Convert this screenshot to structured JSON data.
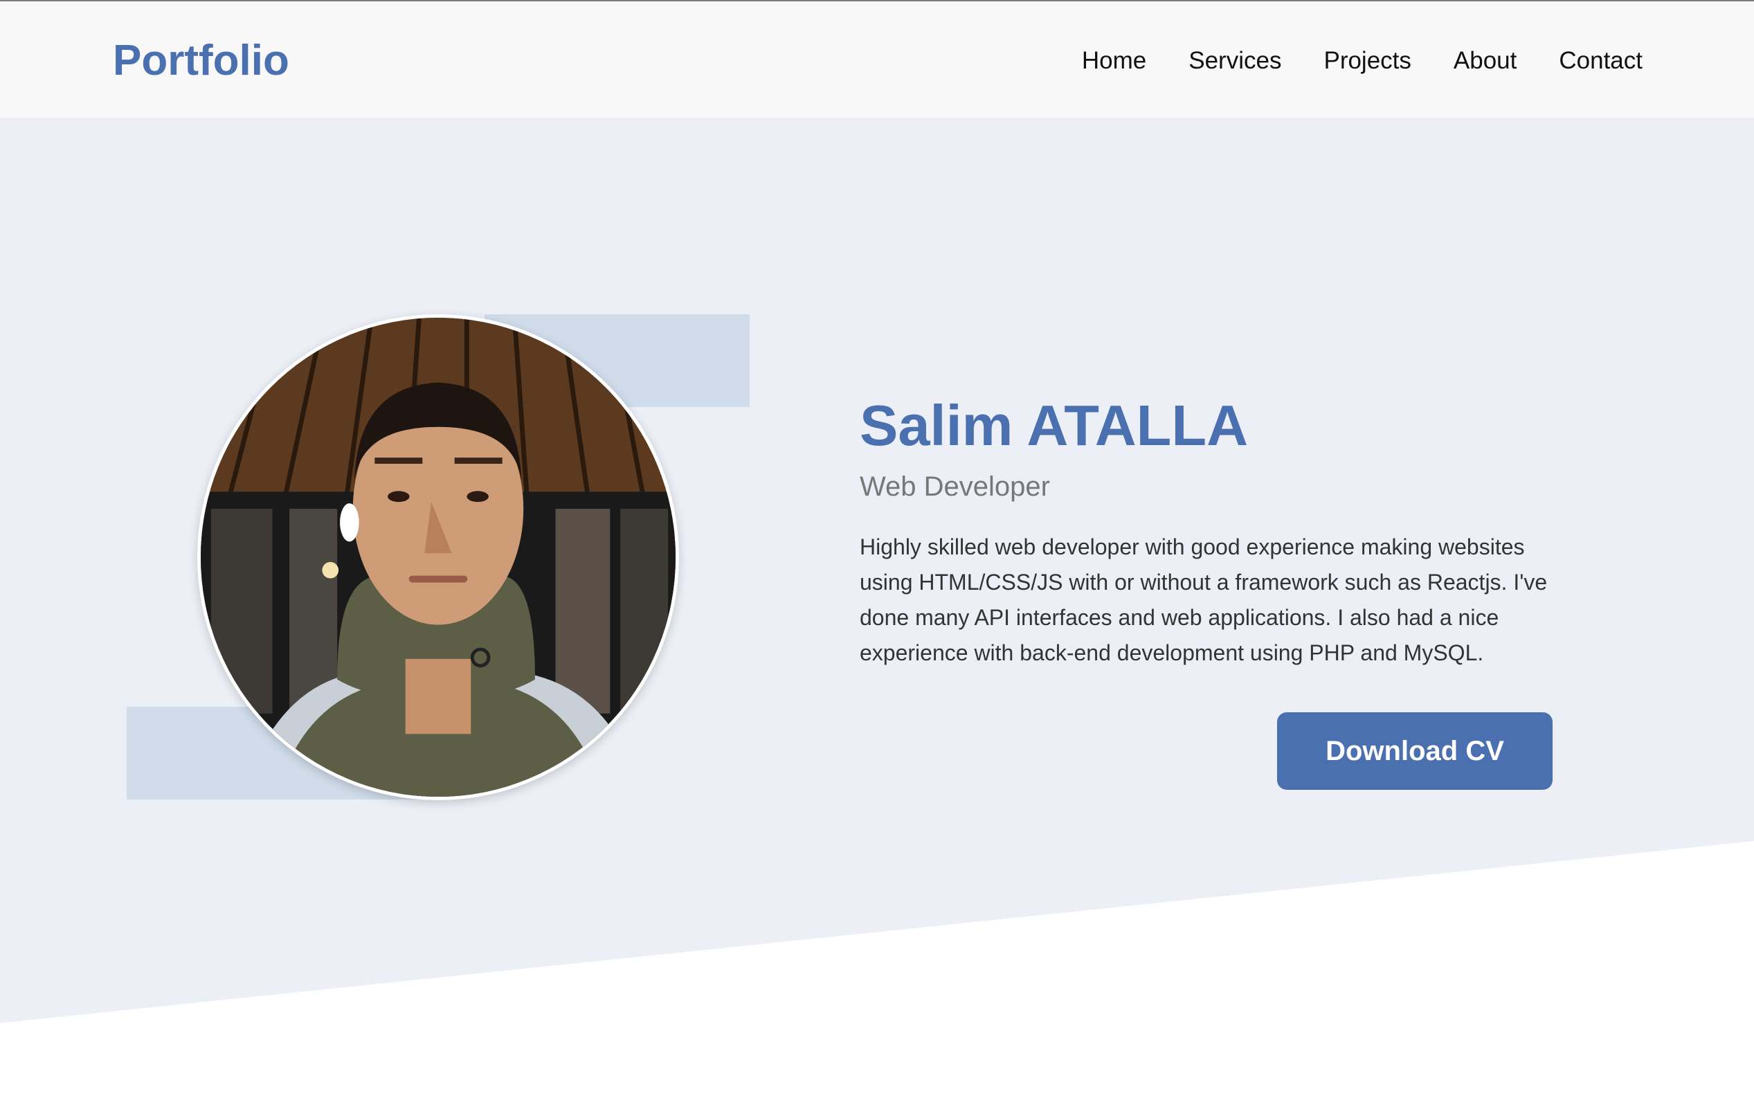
{
  "header": {
    "logo": "Portfolio",
    "nav": [
      "Home",
      "Services",
      "Projects",
      "About",
      "Contact"
    ]
  },
  "hero": {
    "name": "Salim ATALLA",
    "role": "Web Developer",
    "bio": "Highly skilled web developer with good experience making websites using HTML/CSS/JS with or without a framework such as Reactjs. I've done many API interfaces and web applications. I also had a nice experience with back-end development using PHP and MySQL.",
    "download_label": "Download CV"
  },
  "colors": {
    "accent": "#4a70b0",
    "hero_background": "#ecf0f6",
    "decoration": "#d0dcea",
    "header_background": "#f8f8f9"
  }
}
